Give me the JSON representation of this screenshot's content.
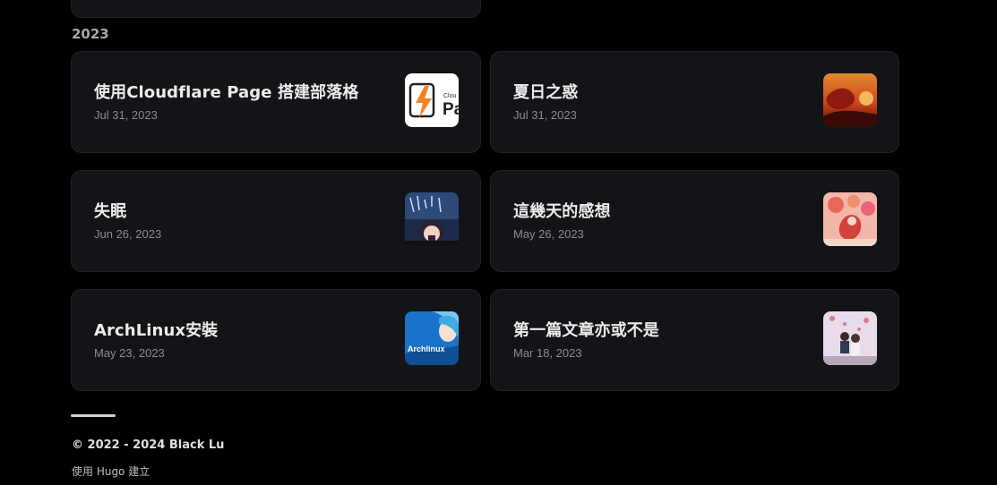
{
  "year_heading": "2023",
  "posts": [
    {
      "title": "使用Cloudflare Page 搭建部落格",
      "date": "Jul 31, 2023",
      "thumb": "cloudflare-pages-logo"
    },
    {
      "title": "夏日之惑",
      "date": "Jul 31, 2023",
      "thumb": "sunset-illustration"
    },
    {
      "title": "失眠",
      "date": "Jun 26, 2023",
      "thumb": "anime-night-illustration"
    },
    {
      "title": "這幾天的感想",
      "date": "May 26, 2023",
      "thumb": "festival-illustration"
    },
    {
      "title": "ArchLinux安裝",
      "date": "May 23, 2023",
      "thumb": "archlinux-mascot"
    },
    {
      "title": "第一篇文章亦或不是",
      "date": "Mar 18, 2023",
      "thumb": "anime-couple-illustration"
    }
  ],
  "footer": {
    "copyright": "© 2022 - 2024 Black Lu",
    "built_with": "使用 Hugo 建立"
  },
  "colors": {
    "background": "#000000",
    "card": "#131417",
    "title": "#ececec",
    "date": "#8c8c8c"
  }
}
